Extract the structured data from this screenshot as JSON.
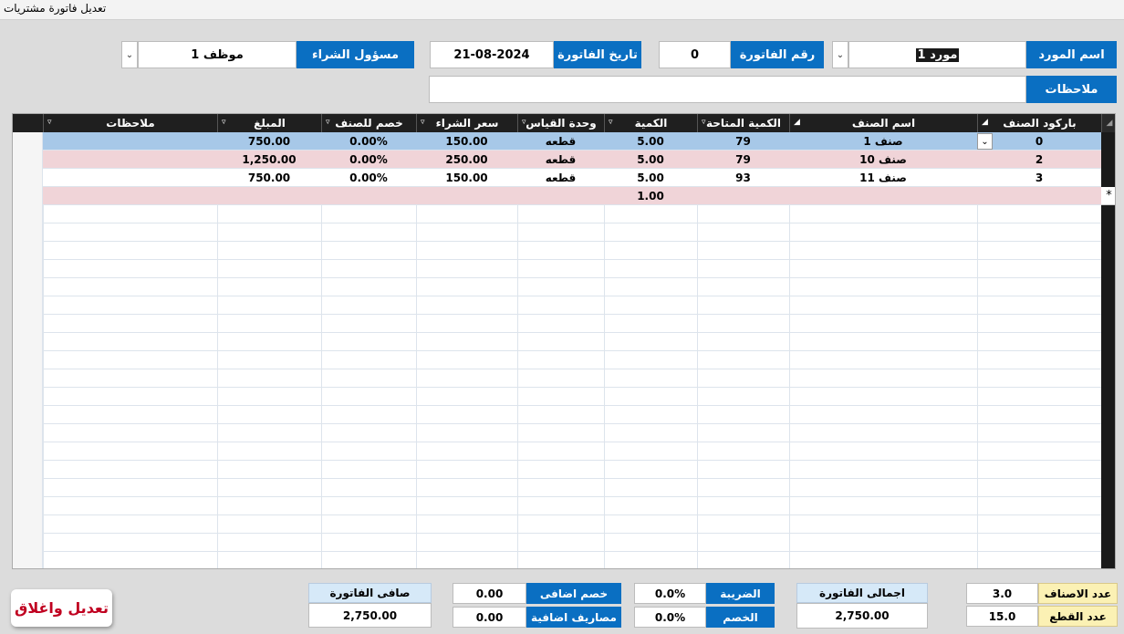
{
  "window": {
    "title": "تعديل فاتورة مشتريات"
  },
  "header": {
    "supplier_label": "اسم المورد",
    "supplier_value": "مورد 1",
    "invoice_number_label": "رقم الفاتورة",
    "invoice_number_value": "0",
    "invoice_date_label": "تاريخ الفاتورة",
    "invoice_date_value": "21-08-2024",
    "buyer_label": "مسؤول الشراء",
    "buyer_value": "موظف 1",
    "notes_label": "ملاحظات",
    "notes_value": ""
  },
  "grid": {
    "columns": [
      "باركود الصنف",
      "اسم الصنف",
      "الكمية المتاحة",
      "الكمية",
      "وحدة القياس",
      "سعر الشراء",
      "خصم للصنف",
      "المبلغ",
      "ملاحظات"
    ],
    "rows": [
      [
        "0",
        "صنف 1",
        "79",
        "5.00",
        "قطعه",
        "150.00",
        "0.00%",
        "750.00",
        ""
      ],
      [
        "2",
        "صنف 10",
        "79",
        "5.00",
        "قطعه",
        "250.00",
        "0.00%",
        "1,250.00",
        ""
      ],
      [
        "3",
        "صنف 11",
        "93",
        "5.00",
        "قطعه",
        "150.00",
        "0.00%",
        "750.00",
        ""
      ],
      [
        "",
        "",
        "",
        "1.00",
        "",
        "",
        "",
        "",
        ""
      ]
    ],
    "new_row_marker": "*"
  },
  "footer": {
    "items_count_label": "عدد الاصناف",
    "items_count_value": "3.0",
    "pieces_count_label": "عدد القطع",
    "pieces_count_value": "15.0",
    "invoice_total_label": "اجمالى الفاتورة",
    "invoice_total_value": "2,750.00",
    "tax_label": "الضريبة",
    "tax_value": "0.0%",
    "discount_label": "الخصم",
    "discount_value": "0.0%",
    "extra_discount_label": "خصم اضافى",
    "extra_discount_value": "0.00",
    "extra_expenses_label": "مصاريف اضافية",
    "extra_expenses_value": "0.00",
    "net_invoice_label": "صافى الفاتورة",
    "net_invoice_value": "2,750.00",
    "save_close_label": "تعديل واغلاق"
  },
  "colors": {
    "accent": "#0a6fc2",
    "selected_row": "#a7c8e8",
    "alt_row": "#f0d4d8",
    "close_text": "#c00020"
  }
}
